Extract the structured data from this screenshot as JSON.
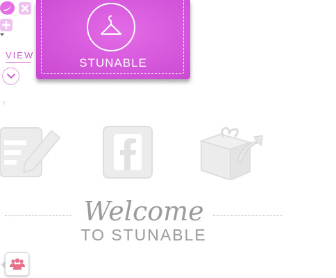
{
  "toolbar": {
    "swirl_icon": "swirl-icon",
    "close_icon": "close-icon",
    "add_icon": "plus-icon",
    "view_label": "VIEW",
    "view_toggle_icon": "chevron-down-icon"
  },
  "logo": {
    "text": "STUNABLE",
    "icon": "hanger-icon",
    "background_color": "#d355da"
  },
  "actions": [
    {
      "name": "edit",
      "icon": "edit-note-icon"
    },
    {
      "name": "facebook",
      "icon": "facebook-icon"
    },
    {
      "name": "share",
      "icon": "gift-share-icon"
    }
  ],
  "welcome": {
    "title": "Welcome",
    "subtitle": "TO STUNABLE"
  },
  "community": {
    "icon": "people-group-icon",
    "color": "#e86f89"
  },
  "colors": {
    "accent": "#d15bd2",
    "muted_gray": "#9b9b9b"
  }
}
